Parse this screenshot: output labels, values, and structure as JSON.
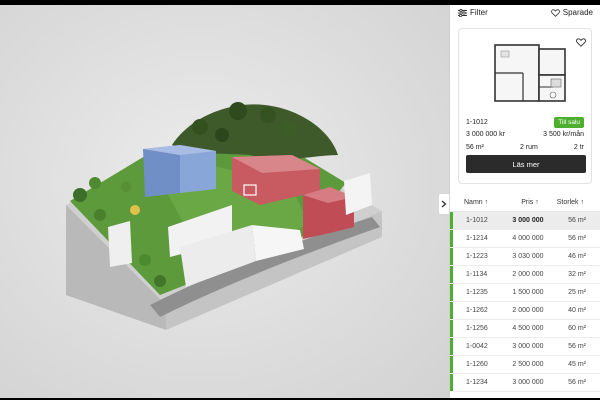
{
  "toolbar": {
    "filter_label": "Filter",
    "saved_label": "Sparade"
  },
  "colors": {
    "accent_green": "#4caf2e",
    "dark_button": "#2b2b2b",
    "highlight_red": "#c84a4a"
  },
  "selected_unit": {
    "id": "1-1012",
    "status": "Till salu",
    "price": "3 000 000 kr",
    "monthly_fee": "3 500 kr/mån",
    "area": "56 m²",
    "rooms": "2 rum",
    "floor": "2 tr",
    "cta_label": "Läs mer"
  },
  "table": {
    "headers": [
      "Namn ↑",
      "Pris ↑",
      "Storlek ↑"
    ],
    "rows": [
      {
        "name": "1-1012",
        "price": "3 000 000",
        "size": "56 m²"
      },
      {
        "name": "1-1214",
        "price": "4 000 000",
        "size": "56 m²"
      },
      {
        "name": "1-1223",
        "price": "3 030 000",
        "size": "46 m²"
      },
      {
        "name": "1-1134",
        "price": "2 000 000",
        "size": "32 m²"
      },
      {
        "name": "1-1235",
        "price": "1 500 000",
        "size": "25 m²"
      },
      {
        "name": "1-1262",
        "price": "2 000 000",
        "size": "40 m²"
      },
      {
        "name": "1-1256",
        "price": "4 500 000",
        "size": "60 m²"
      },
      {
        "name": "1-0042",
        "price": "3 000 000",
        "size": "56 m²"
      },
      {
        "name": "1-1260",
        "price": "2 500 000",
        "size": "45 m²"
      },
      {
        "name": "1-1234",
        "price": "3 000 000",
        "size": "56 m²"
      }
    ]
  },
  "icons": {
    "filter": "sliders-icon",
    "saved": "heart-outline-icon",
    "collapse": "chevron-right-icon"
  }
}
